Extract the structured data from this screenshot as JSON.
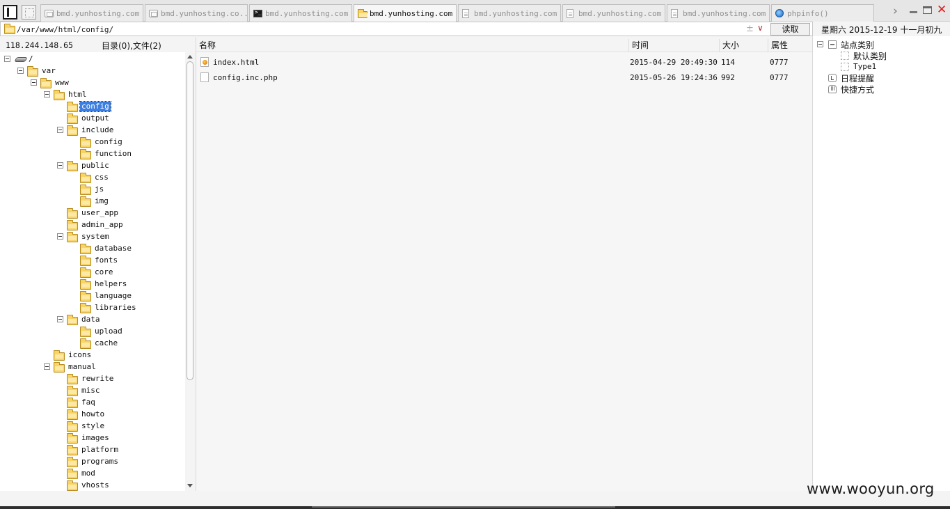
{
  "tabs": [
    {
      "label": "bmd.yunhosting.com",
      "icon": "database-icon",
      "active": false
    },
    {
      "label": "bmd.yunhosting.co...",
      "icon": "database-icon",
      "active": false
    },
    {
      "label": "bmd.yunhosting.com",
      "icon": "terminal-icon",
      "active": false
    },
    {
      "label": "bmd.yunhosting.com",
      "icon": "folder-icon",
      "active": true
    },
    {
      "label": "bmd.yunhosting.com",
      "icon": "document-icon",
      "active": false
    },
    {
      "label": "bmd.yunhosting.com",
      "icon": "document-icon",
      "active": false
    },
    {
      "label": "bmd.yunhosting.com",
      "icon": "document-icon",
      "active": false
    },
    {
      "label": "phpinfo()",
      "icon": "globe-icon",
      "active": false
    }
  ],
  "pathbar": {
    "value": "/var/www/html/config/",
    "read_label": "读取"
  },
  "date_text": "星期六 2015-12-19 十一月初九",
  "left_header": {
    "ip": "118.244.148.65",
    "counts": "目录(0),文件(2)"
  },
  "tree": [
    {
      "label": "/",
      "drive": true,
      "expanded": true,
      "level": 0
    },
    {
      "label": "var",
      "expanded": true,
      "level": 1
    },
    {
      "label": "www",
      "expanded": true,
      "level": 2
    },
    {
      "label": "html",
      "expanded": true,
      "level": 3
    },
    {
      "label": "config",
      "level": 4,
      "selected": true
    },
    {
      "label": "output",
      "level": 4
    },
    {
      "label": "include",
      "expanded": true,
      "level": 4
    },
    {
      "label": "config",
      "level": 5
    },
    {
      "label": "function",
      "level": 5
    },
    {
      "label": "public",
      "expanded": true,
      "level": 4
    },
    {
      "label": "css",
      "level": 5
    },
    {
      "label": "js",
      "level": 5
    },
    {
      "label": "img",
      "level": 5
    },
    {
      "label": "user_app",
      "level": 4
    },
    {
      "label": "admin_app",
      "level": 4
    },
    {
      "label": "system",
      "expanded": true,
      "level": 4
    },
    {
      "label": "database",
      "level": 5
    },
    {
      "label": "fonts",
      "level": 5
    },
    {
      "label": "core",
      "level": 5
    },
    {
      "label": "helpers",
      "level": 5
    },
    {
      "label": "language",
      "level": 5
    },
    {
      "label": "libraries",
      "level": 5
    },
    {
      "label": "data",
      "expanded": true,
      "level": 4
    },
    {
      "label": "upload",
      "level": 5
    },
    {
      "label": "cache",
      "level": 5
    },
    {
      "label": "icons",
      "level": 3
    },
    {
      "label": "manual",
      "expanded": true,
      "level": 3
    },
    {
      "label": "rewrite",
      "level": 4
    },
    {
      "label": "misc",
      "level": 4
    },
    {
      "label": "faq",
      "level": 4
    },
    {
      "label": "howto",
      "level": 4
    },
    {
      "label": "style",
      "level": 4
    },
    {
      "label": "images",
      "level": 4
    },
    {
      "label": "platform",
      "level": 4
    },
    {
      "label": "programs",
      "level": 4
    },
    {
      "label": "mod",
      "level": 4
    },
    {
      "label": "vhosts",
      "level": 4
    }
  ],
  "file_columns": {
    "name": "名称",
    "time": "时间",
    "size": "大小",
    "attr": "属性"
  },
  "files": [
    {
      "name": "index.html",
      "time": "2015-04-29 20:49:30",
      "size": "114",
      "attr": "0777",
      "type": "html"
    },
    {
      "name": "config.inc.php",
      "time": "2015-05-26 19:24:36",
      "size": "992",
      "attr": "0777",
      "type": "php"
    }
  ],
  "right_tree": [
    {
      "label": "站点类别",
      "icon": "category-icon",
      "expanded": true,
      "level": 0
    },
    {
      "label": "默认类别",
      "icon": "dotted-box-icon",
      "level": 1
    },
    {
      "label": "Type1",
      "icon": "dotted-box-icon",
      "level": 1
    },
    {
      "label": "日程提醒",
      "icon": "schedule-icon",
      "level": 0
    },
    {
      "label": "快捷方式",
      "icon": "shortcut-icon",
      "level": 0
    }
  ],
  "watermark": "www.wooyun.org",
  "colors": {
    "selection": "#3c7fe0",
    "folder": "#f7d465",
    "close": "#e31b1b"
  }
}
